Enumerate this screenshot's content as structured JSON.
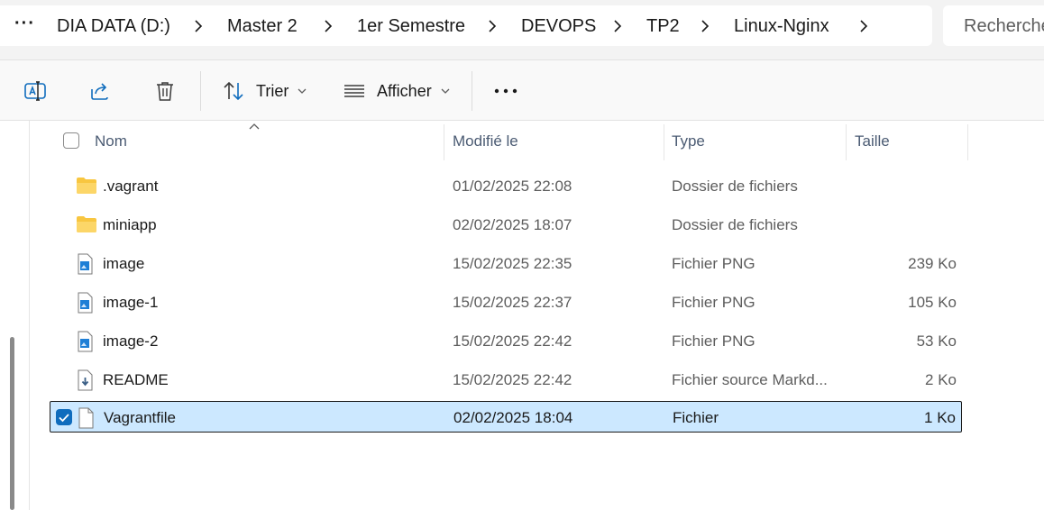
{
  "address_bar": {
    "more_label": "···",
    "segments": [
      "DIA DATA (D:)",
      "Master 2",
      "1er Semestre",
      "DEVOPS",
      "TP2",
      "Linux-Nginx"
    ]
  },
  "search": {
    "placeholder": "Rechercher"
  },
  "toolbar": {
    "icons": [
      "rename-icon",
      "share-icon",
      "delete-icon"
    ],
    "sort_label": "Trier",
    "view_label": "Afficher",
    "more_label": "···"
  },
  "columns": {
    "name": "Nom",
    "modified": "Modifié le",
    "type": "Type",
    "size": "Taille"
  },
  "files": [
    {
      "name": ".vagrant",
      "modified": "01/02/2025 22:08",
      "type": "Dossier de fichiers",
      "size": "",
      "icon": "folder-icon",
      "selected": false
    },
    {
      "name": "miniapp",
      "modified": "02/02/2025 18:07",
      "type": "Dossier de fichiers",
      "size": "",
      "icon": "folder-icon",
      "selected": false
    },
    {
      "name": "image",
      "modified": "15/02/2025 22:35",
      "type": "Fichier PNG",
      "size": "239 Ko",
      "icon": "image-file-icon",
      "selected": false
    },
    {
      "name": "image-1",
      "modified": "15/02/2025 22:37",
      "type": "Fichier PNG",
      "size": "105 Ko",
      "icon": "image-file-icon",
      "selected": false
    },
    {
      "name": "image-2",
      "modified": "15/02/2025 22:42",
      "type": "Fichier PNG",
      "size": "53 Ko",
      "icon": "image-file-icon",
      "selected": false
    },
    {
      "name": "README",
      "modified": "15/02/2025 22:42",
      "type": "Fichier source Markd...",
      "size": "2 Ko",
      "icon": "markdown-file-icon",
      "selected": false
    },
    {
      "name": "Vagrantfile",
      "modified": "02/02/2025 18:04",
      "type": "Fichier",
      "size": "1 Ko",
      "icon": "blank-file-icon",
      "selected": true
    }
  ],
  "colors": {
    "accent": "#0f6cbd",
    "selection_bg": "#cce8ff",
    "folder": "#f8c640"
  }
}
